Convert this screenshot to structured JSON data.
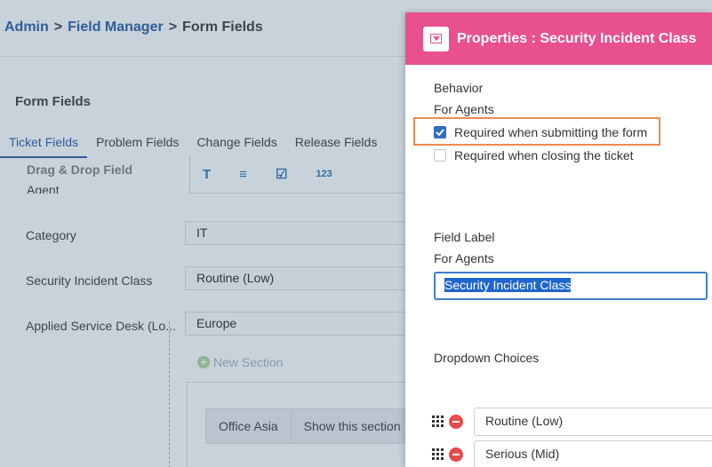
{
  "breadcrumb": {
    "admin": "Admin",
    "field_manager": "Field Manager",
    "current": "Form Fields",
    "separator": ">"
  },
  "page": {
    "title": "Form Fields",
    "tabs": [
      {
        "label": "Ticket Fields",
        "active": true
      },
      {
        "label": "Problem Fields",
        "active": false
      },
      {
        "label": "Change Fields",
        "active": false
      },
      {
        "label": "Release Fields",
        "active": false
      }
    ],
    "drag_drop_label": "Drag & Drop Field",
    "toolbar_icons": [
      {
        "name": "text-icon",
        "glyph": "T"
      },
      {
        "name": "paragraph-icon",
        "glyph": "≡"
      },
      {
        "name": "checkbox-icon",
        "glyph": "☑"
      },
      {
        "name": "number-icon",
        "glyph": "123"
      }
    ],
    "cut_label": "Agent",
    "rows": [
      {
        "label": "Category",
        "value": "IT"
      },
      {
        "label": "Security Incident Class",
        "value": "Routine (Low)"
      },
      {
        "label": "Applied Service Desk (Lo...",
        "value": "Europe"
      }
    ],
    "new_section": "New Section",
    "section_cells": [
      "Office Asia",
      "Show this section"
    ]
  },
  "panel": {
    "title": "Properties : Security Incident Class",
    "behavior_label": "Behavior",
    "for_agents_1": "For Agents",
    "required_submit": {
      "label": "Required when submitting the form",
      "checked": true
    },
    "required_close": {
      "label": "Required when closing the ticket",
      "checked": false
    },
    "field_label_heading": "Field Label",
    "for_agents_2": "For Agents",
    "field_label_value": "Security Incident Class",
    "dropdown_choices_label": "Dropdown Choices",
    "choices": [
      "Routine (Low)",
      "Serious (Mid)"
    ]
  },
  "colors": {
    "panel_header": "#e8508f",
    "link": "#2f5d97",
    "highlight_border": "#ee8a4f",
    "checkbox_checked": "#2f6fbf",
    "remove_button": "#e44b4b"
  }
}
